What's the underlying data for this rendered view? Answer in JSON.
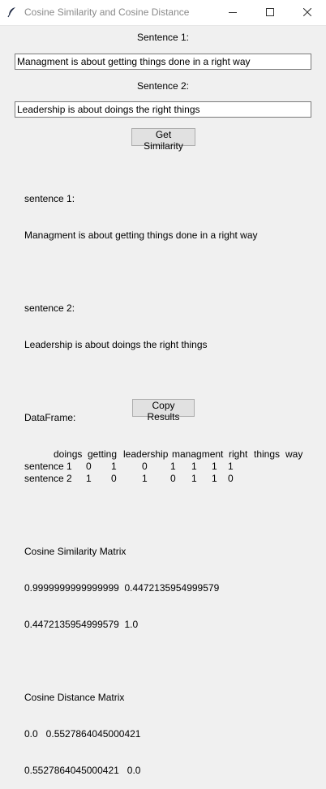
{
  "window": {
    "title": "Cosine Similarity and Cosine Distance",
    "icon": "feather-icon",
    "controls": [
      "minimize-icon",
      "maximize-icon",
      "close-icon"
    ]
  },
  "form": {
    "sentence1_label": "Sentence 1:",
    "sentence1_value": "Managment is about getting things done in a right way",
    "sentence2_label": "Sentence 2:",
    "sentence2_value": "Leadership is about doings the right things",
    "get_button": "Get Similarity"
  },
  "output": {
    "s1_header": "sentence 1:",
    "s1_text": "Managment is about getting things done in a right way",
    "s2_header": "sentence 2:",
    "s2_text": "Leadership is about doings the right things",
    "df_header": "DataFrame:",
    "df_columns": [
      "doings",
      "getting",
      "leadership",
      "managment",
      "right",
      "things",
      "way"
    ],
    "df_rows": [
      {
        "index": "sentence 1",
        "values": [
          "0",
          "1",
          "0",
          "1",
          "1",
          "1",
          "1"
        ]
      },
      {
        "index": "sentence 2",
        "values": [
          "1",
          "0",
          "1",
          "0",
          "1",
          "1",
          "0"
        ]
      }
    ],
    "sim_header": "Cosine Similarity Matrix",
    "sim_row1": "0.9999999999999999  0.4472135954999579",
    "sim_row2": "0.4472135954999579  1.0",
    "dist_header": "Cosine Distance Matrix",
    "dist_row1": "0.0   0.5527864045000421",
    "dist_row2": "0.5527864045000421   0.0"
  },
  "copy_button": "Copy Results"
}
